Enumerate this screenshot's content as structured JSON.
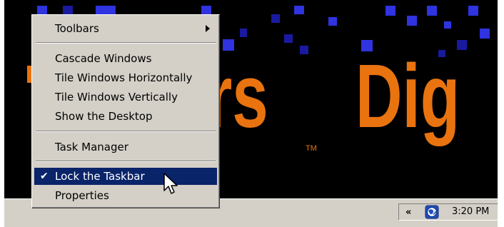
{
  "menu": {
    "items": [
      {
        "label": "Toolbars"
      },
      {
        "label": "Cascade Windows"
      },
      {
        "label": "Tile Windows Horizontally"
      },
      {
        "label": "Tile Windows Vertically"
      },
      {
        "label": "Show the Desktop"
      },
      {
        "label": "Task Manager"
      },
      {
        "label": "Lock the Taskbar",
        "checked": true,
        "highlighted": true
      },
      {
        "label": "Properties"
      }
    ],
    "check_glyph": "✔",
    "submenu_icon": "triangle-right-icon"
  },
  "wallpaper": {
    "text_left": "rs",
    "text_right": "Dig",
    "trademark": "TM",
    "text_color": "#e8730f",
    "square_color": "#2626d9"
  },
  "taskbar": {
    "tray_chevron": "«",
    "tray_icon": "network-globe-icon",
    "clock": "3:20 PM"
  },
  "colors": {
    "menu_bg": "#d4d0c8",
    "highlight": "#0a246a"
  }
}
